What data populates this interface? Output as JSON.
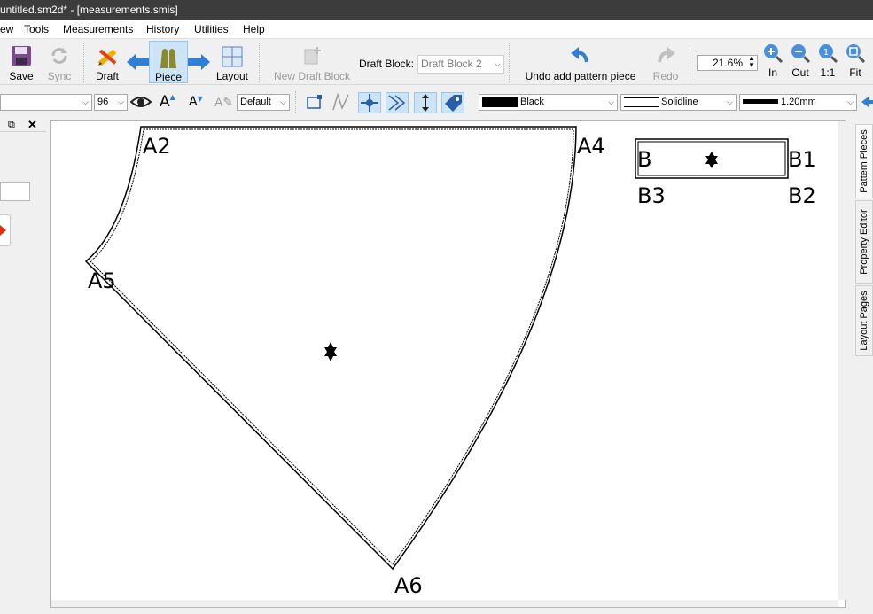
{
  "window": {
    "title": "untitled.sm2d* - [measurements.smis]"
  },
  "menu": [
    "ew",
    "Tools",
    "Measurements",
    "History",
    "Utilities",
    "Help"
  ],
  "toolbar": {
    "save": "Save",
    "sync": "Sync",
    "draft": "Draft",
    "piece": "Piece",
    "layout": "Layout",
    "new_draft_block": "New Draft Block",
    "draft_block_label": "Draft Block:",
    "draft_block_value": "Draft Block 2",
    "undo": "Undo add pattern piece",
    "redo": "Redo",
    "zoom_value": "21.6%",
    "zoom_in": "In",
    "zoom_out": "Out",
    "zoom_actual": "1:1",
    "zoom_fit": "Fit"
  },
  "toolbar2": {
    "font_size": "96",
    "text_default": "Default",
    "color": "Black",
    "line_type": "Solidline",
    "line_weight": "1.20mm"
  },
  "right_tabs": [
    "Pattern Pieces",
    "Property Editor",
    "Layout Pages"
  ],
  "pieces": {
    "piece_a": {
      "points": [
        "A2",
        "A4",
        "A5",
        "A6"
      ]
    },
    "piece_b": {
      "points": [
        "B",
        "B1",
        "B3",
        "B2"
      ]
    }
  }
}
